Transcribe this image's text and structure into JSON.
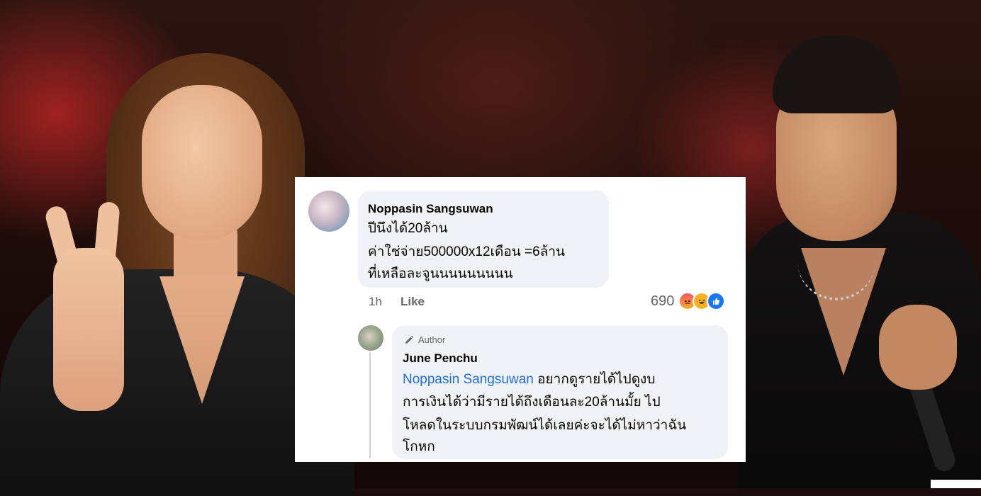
{
  "comment": {
    "author": "Noppasin Sangsuwan",
    "lines": [
      "ปีนึงได้20ล้าน",
      "ค่าใช่จ่าย500000x12เดือน =6ล้าน",
      "ที่เหลือละจูนนนนนนนนน"
    ],
    "time": "1h",
    "like_label": "Like",
    "reaction_count": "690",
    "reactions": [
      "angry-icon",
      "haha-icon",
      "like-icon"
    ]
  },
  "reply": {
    "badge": "Author",
    "author": "June Penchu",
    "mention": "Noppasin Sangsuwan",
    "first_line_rest": " อยากดูรายได้ไปดูงบ",
    "lines": [
      "การเงินได้ว่ามีรายได้ถึงเดือนละ20ล้านมั้ย ไป",
      "โหลดในระบบกรมพัฒน์ได้เลยค่ะจะได้ไม่หาว่าฉัน",
      "โกหก"
    ]
  },
  "colors": {
    "link": "#216fdb",
    "bubble": "#f0f2f5",
    "meta": "#65676b"
  }
}
